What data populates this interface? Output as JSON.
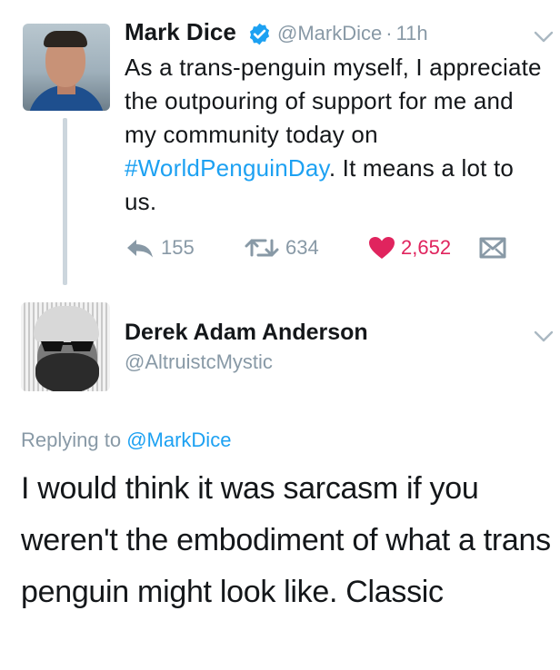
{
  "tweet": {
    "author_name": "Mark Dice",
    "handle": "@MarkDice",
    "separator": "·",
    "time": "11h",
    "text_before": "As a trans-penguin myself, I appreciate the outpouring of support for me and my community today on ",
    "hashtag": "#WorldPenguinDay",
    "text_after": ".  It means a lot to us.",
    "replies": "155",
    "retweets": "634",
    "likes": "2,652"
  },
  "reply": {
    "author_name": "Derek Adam Anderson",
    "handle": "@AltruistcMystic",
    "replying_label": "Replying to",
    "replying_to": "@MarkDice",
    "text": "I would think it was sarcasm if you weren't the embodiment of what a trans penguin might look like. Classic"
  },
  "icons": [
    "verified-badge-icon",
    "chevron-down-icon",
    "reply-icon",
    "retweet-icon",
    "heart-icon",
    "direct-message-icon"
  ],
  "colors": {
    "accent": "#1da1f2",
    "secondary_text": "#8899a6",
    "like": "#e0245e",
    "thread_line": "#ccd6dd"
  }
}
